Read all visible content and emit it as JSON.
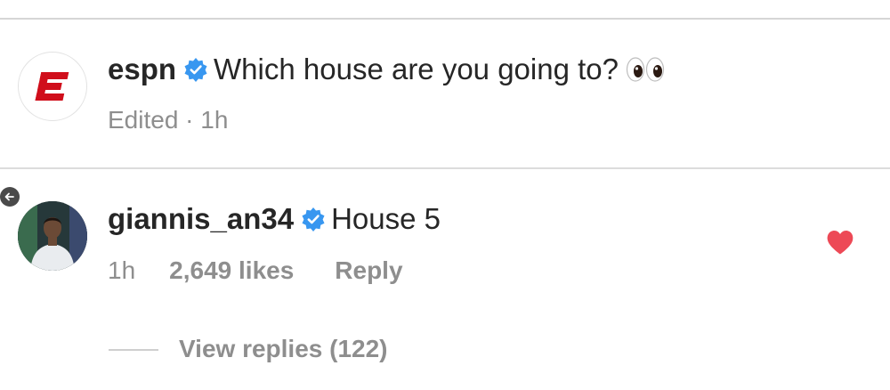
{
  "caption": {
    "username": "espn",
    "verified": true,
    "text": "Which house are you going to?",
    "emoji": "eyes",
    "meta": "Edited · 1h"
  },
  "comment": {
    "username": "giannis_an34",
    "verified": true,
    "text": "House 5",
    "time": "1h",
    "likes": "2,649 likes",
    "reply_label": "Reply",
    "liked": true
  },
  "view_replies": "View replies (122)",
  "icons": {
    "verified": "verified-badge-icon",
    "heart": "heart-icon",
    "back": "back-arrow-icon",
    "eyes": "eyes-emoji-icon"
  },
  "colors": {
    "verified_blue": "#3897f0",
    "heart_red": "#ed4956",
    "espn_red": "#d00e1b",
    "meta_gray": "#8e8e8e"
  }
}
